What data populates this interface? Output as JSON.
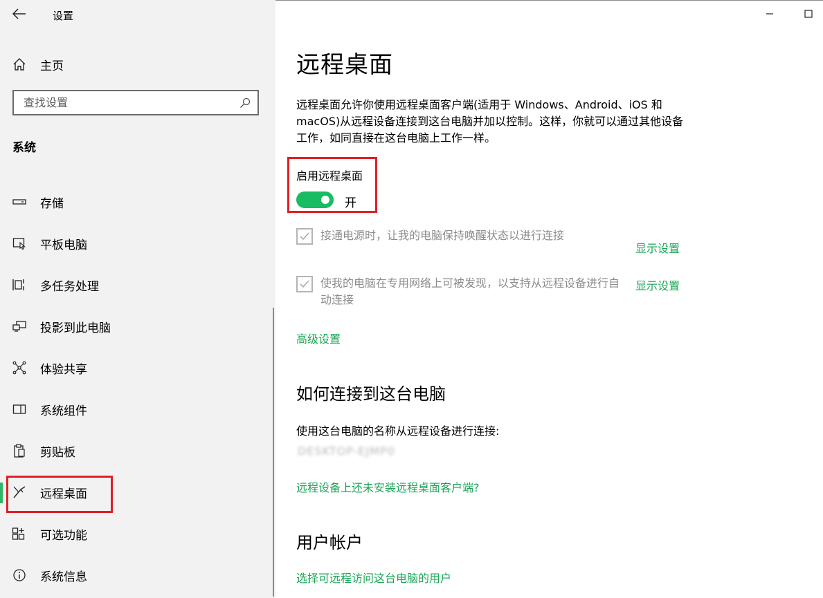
{
  "window": {
    "title": "设置",
    "minimize_icon": "minimize-icon",
    "maximize_icon": "maximize-icon"
  },
  "sidebar": {
    "home_label": "主页",
    "search_placeholder": "查找设置",
    "section_label": "系统",
    "items": [
      {
        "label": "存储",
        "icon": "storage-icon"
      },
      {
        "label": "平板电脑",
        "icon": "tablet-icon"
      },
      {
        "label": "多任务处理",
        "icon": "multitasking-icon"
      },
      {
        "label": "投影到此电脑",
        "icon": "project-icon"
      },
      {
        "label": "体验共享",
        "icon": "share-icon"
      },
      {
        "label": "系统组件",
        "icon": "components-icon"
      },
      {
        "label": "剪贴板",
        "icon": "clipboard-icon"
      },
      {
        "label": "远程桌面",
        "icon": "remote-desktop-icon",
        "active": true
      },
      {
        "label": "可选功能",
        "icon": "optional-features-icon"
      },
      {
        "label": "系统信息",
        "icon": "info-icon"
      }
    ]
  },
  "main": {
    "title": "远程桌面",
    "description": "远程桌面允许你使用远程桌面客户端(适用于 Windows、Android、iOS 和 macOS)从远程设备连接到这台电脑并加以控制。这样，你就可以通过其他设备工作，如同直接在这台电脑上工作一样。",
    "toggle": {
      "label": "启用远程桌面",
      "state": "开",
      "on": true
    },
    "options": [
      {
        "text": "接通电源时，让我的电脑保持唤醒状态以进行连接",
        "link": "显示设置",
        "checked": true
      },
      {
        "text": "使我的电脑在专用网络上可被发现，以支持从远程设备进行自动连接",
        "link": "显示设置",
        "checked": true
      }
    ],
    "advanced_link": "高级设置",
    "connect_section": {
      "heading": "如何连接到这台电脑",
      "instruction": "使用这台电脑的名称从远程设备进行连接:",
      "pc_name": "DESKTOP-EJMP0",
      "client_link": "远程设备上还未安装远程桌面客户端?"
    },
    "accounts_section": {
      "heading": "用户帐户",
      "link": "选择可远程访问这台电脑的用户"
    }
  },
  "colors": {
    "accent": "#1aa556",
    "toggle_on": "#19bc63",
    "highlight": "#e01f25",
    "sidebar_bg": "#f2f2f2"
  }
}
